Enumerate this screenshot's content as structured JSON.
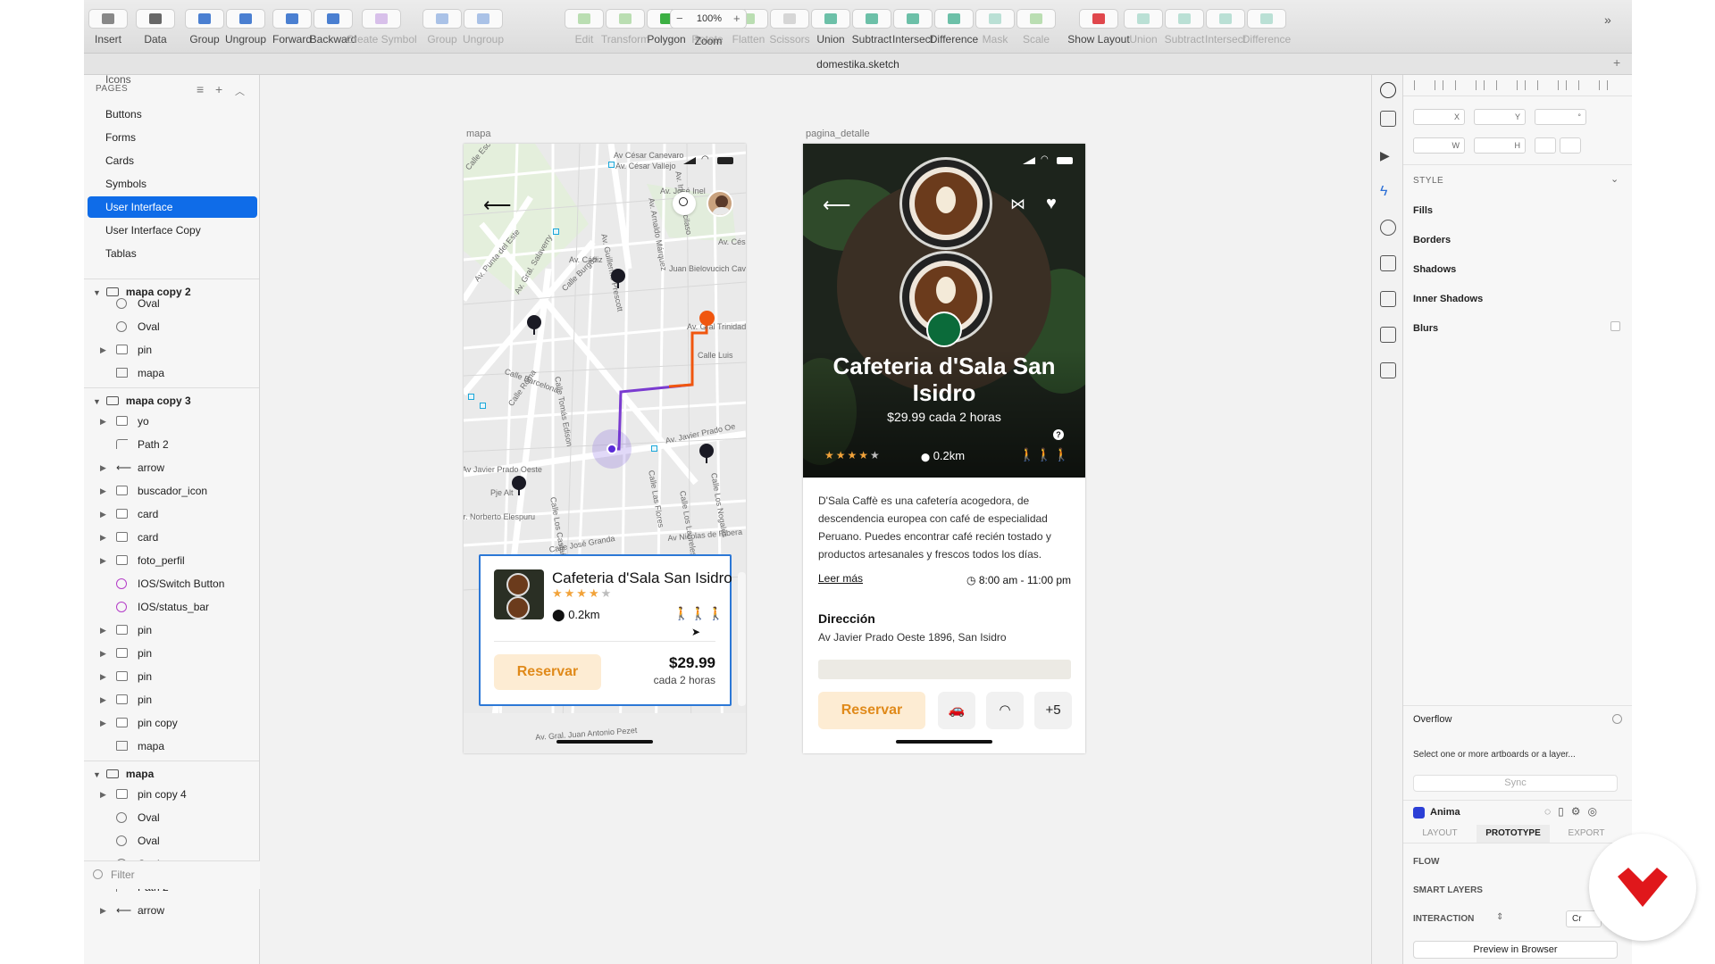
{
  "toolbar": {
    "items": [
      {
        "label": "Insert",
        "color": "#888888"
      },
      {
        "label": "Data",
        "color": "#666666"
      },
      {
        "label": "Group",
        "color": "#4a7fd1"
      },
      {
        "label": "Ungroup",
        "color": "#4a7fd1"
      },
      {
        "label": "Forward",
        "color": "#4a7fd1"
      },
      {
        "label": "Backward",
        "color": "#4a7fd1"
      },
      {
        "label": "Create Symbol",
        "color": "#b07ad8",
        "disabled": true
      },
      {
        "label": "Group",
        "color": "#4a7fd1",
        "disabled": true
      },
      {
        "label": "Ungroup",
        "color": "#4a7fd1",
        "disabled": true
      },
      {
        "label": "Zoom",
        "color": "#666666"
      },
      {
        "label": "Edit",
        "color": "#6cbd5a",
        "disabled": true
      },
      {
        "label": "Transform",
        "color": "#6cbd5a",
        "disabled": true
      },
      {
        "label": "Polygon",
        "color": "#3cb043"
      },
      {
        "label": "Rotate",
        "color": "#6cbd5a",
        "disabled": true
      },
      {
        "label": "Flatten",
        "color": "#6cbd5a",
        "disabled": true
      },
      {
        "label": "Scissors",
        "color": "#aaaaaa",
        "disabled": true
      },
      {
        "label": "Union",
        "color": "#6cc0a8"
      },
      {
        "label": "Subtract",
        "color": "#6cc0a8"
      },
      {
        "label": "Intersect",
        "color": "#6cc0a8"
      },
      {
        "label": "Difference",
        "color": "#6cc0a8"
      },
      {
        "label": "Mask",
        "color": "#6cc0a8",
        "disabled": true
      },
      {
        "label": "Scale",
        "color": "#6cbd5a",
        "disabled": true
      },
      {
        "label": "Show Layout",
        "color": "#e0474c"
      },
      {
        "label": "Union",
        "color": "#6cc0a8",
        "disabled": true
      },
      {
        "label": "Subtract",
        "color": "#6cc0a8",
        "disabled": true
      },
      {
        "label": "Intersect",
        "color": "#6cc0a8",
        "disabled": true
      },
      {
        "label": "Difference",
        "color": "#6cc0a8",
        "disabled": true
      }
    ],
    "zoom_value": "100%"
  },
  "window": {
    "title": "domestika.sketch"
  },
  "layers_panel": {
    "pages_header": "PAGES",
    "pages": [
      "Icons",
      "Buttons",
      "Forms",
      "Cards",
      "Symbols",
      "User Interface",
      "User Interface Copy",
      "Tablas"
    ],
    "selected_page": "User Interface",
    "groups": [
      {
        "name": "mapa copy 2",
        "layers": [
          {
            "name": "Oval",
            "type": "oval"
          },
          {
            "name": "Oval",
            "type": "oval"
          },
          {
            "name": "pin",
            "type": "folder"
          },
          {
            "name": "mapa",
            "type": "image"
          }
        ]
      },
      {
        "name": "mapa copy 3",
        "layers": [
          {
            "name": "yo",
            "type": "folder"
          },
          {
            "name": "Path 2",
            "type": "path"
          },
          {
            "name": "arrow",
            "type": "arrow"
          },
          {
            "name": "buscador_icon",
            "type": "folder"
          },
          {
            "name": "card",
            "type": "folder"
          },
          {
            "name": "card",
            "type": "folder"
          },
          {
            "name": "foto_perfil",
            "type": "folder"
          },
          {
            "name": "IOS/Switch Button",
            "type": "symbol"
          },
          {
            "name": "IOS/status_bar",
            "type": "symbol"
          },
          {
            "name": "pin",
            "type": "folder"
          },
          {
            "name": "pin",
            "type": "folder"
          },
          {
            "name": "pin",
            "type": "folder"
          },
          {
            "name": "pin",
            "type": "folder"
          },
          {
            "name": "pin copy",
            "type": "folder"
          },
          {
            "name": "mapa",
            "type": "image"
          }
        ]
      },
      {
        "name": "mapa",
        "layers": [
          {
            "name": "pin copy 4",
            "type": "folder"
          },
          {
            "name": "Oval",
            "type": "oval"
          },
          {
            "name": "Oval",
            "type": "oval"
          },
          {
            "name": "Oval",
            "type": "oval"
          },
          {
            "name": "Path 2",
            "type": "path"
          },
          {
            "name": "arrow",
            "type": "arrow"
          }
        ]
      }
    ],
    "filter_placeholder": "Filter"
  },
  "artboards": {
    "map": {
      "label": "mapa",
      "streets": [
        "Av César Canevaro",
        "Av. César Vallejo",
        "Av. Cés",
        "Av. Guillermo Prescott",
        "Av. Arnaldo Márquez",
        "Av. Punta del Este",
        "Av. Gral. Salaverry",
        "Av. Cádiz",
        "Calle Burgos",
        "Calle Barcelona",
        "Calle Roma",
        "Calle Tomás Edison",
        "Av Javier Prado Oeste",
        "Av. Javier Prado Oe",
        "Calle Las Flores",
        "Calle José Granda",
        "Av Nicolas de Ribera",
        "Av. Gral. Juan Antonio Pezet",
        "Juan Bielovucich Cava",
        "Av. Gral Trinidad M",
        "Calle Luis",
        "Calle Los Castaños",
        "Calle Los Laureles",
        "Calle Los Nogales",
        "Jr. Norberto Elespuru",
        "Pje Alt",
        "Calle Esco",
        "Av. Inca Garcilaso",
        "Av. José Inel"
      ],
      "card": {
        "title": "Cafeteria d'Sala San Isidro",
        "rating": 4,
        "rating_max": 5,
        "distance": "0.2km",
        "book_button": "Reservar",
        "price": "$29.99",
        "price_period": "cada 2 horas"
      }
    },
    "detail": {
      "label": "pagina_detalle",
      "title": "Cafeteria d'Sala San Isidro",
      "subtitle": "$29.99 cada 2 horas",
      "rating": 4,
      "rating_max": 5,
      "distance": "0.2km",
      "help_badge": "?",
      "description": "D'Sala Caffè es una cafetería acogedora, de descendencia europea con café de especialidad Peruano. Puedes encontrar café recién tostado y productos artesanales y frescos todos los días.",
      "read_more": "Leer más",
      "hours": "8:00 am - 11:00 pm",
      "address_heading": "Dirección",
      "address": "Av Javier Prado Oeste 1896, San Isidro",
      "book_button": "Reservar",
      "amenities_more": "+5"
    }
  },
  "inspector": {
    "x_label": "X",
    "y_label": "Y",
    "rot_label": "°",
    "w_label": "W",
    "h_label": "H",
    "style_header": "STYLE",
    "sections": [
      "Fills",
      "Borders",
      "Shadows",
      "Inner Shadows",
      "Blurs"
    ],
    "overflow_title": "Overflow",
    "overflow_text": "Select one or more artboards or a layer...",
    "sync_button": "Sync",
    "anima_title": "Anima",
    "tabs": [
      "LAYOUT",
      "PROTOTYPE",
      "EXPORT"
    ],
    "active_tab": "PROTOTYPE",
    "flow_label": "FLOW",
    "smart_layers_label": "SMART LAYERS",
    "interaction_label": "INTERACTION",
    "interaction_value": "Cr",
    "preview_button": "Preview in Browser"
  },
  "colors": {
    "selection": "#0f6ce8",
    "route_start": "#5a2bd8",
    "route_end": "#f0560f",
    "accent_orange": "#e08a1a",
    "card_border": "#2c78d6",
    "brand": "#e0171b"
  }
}
